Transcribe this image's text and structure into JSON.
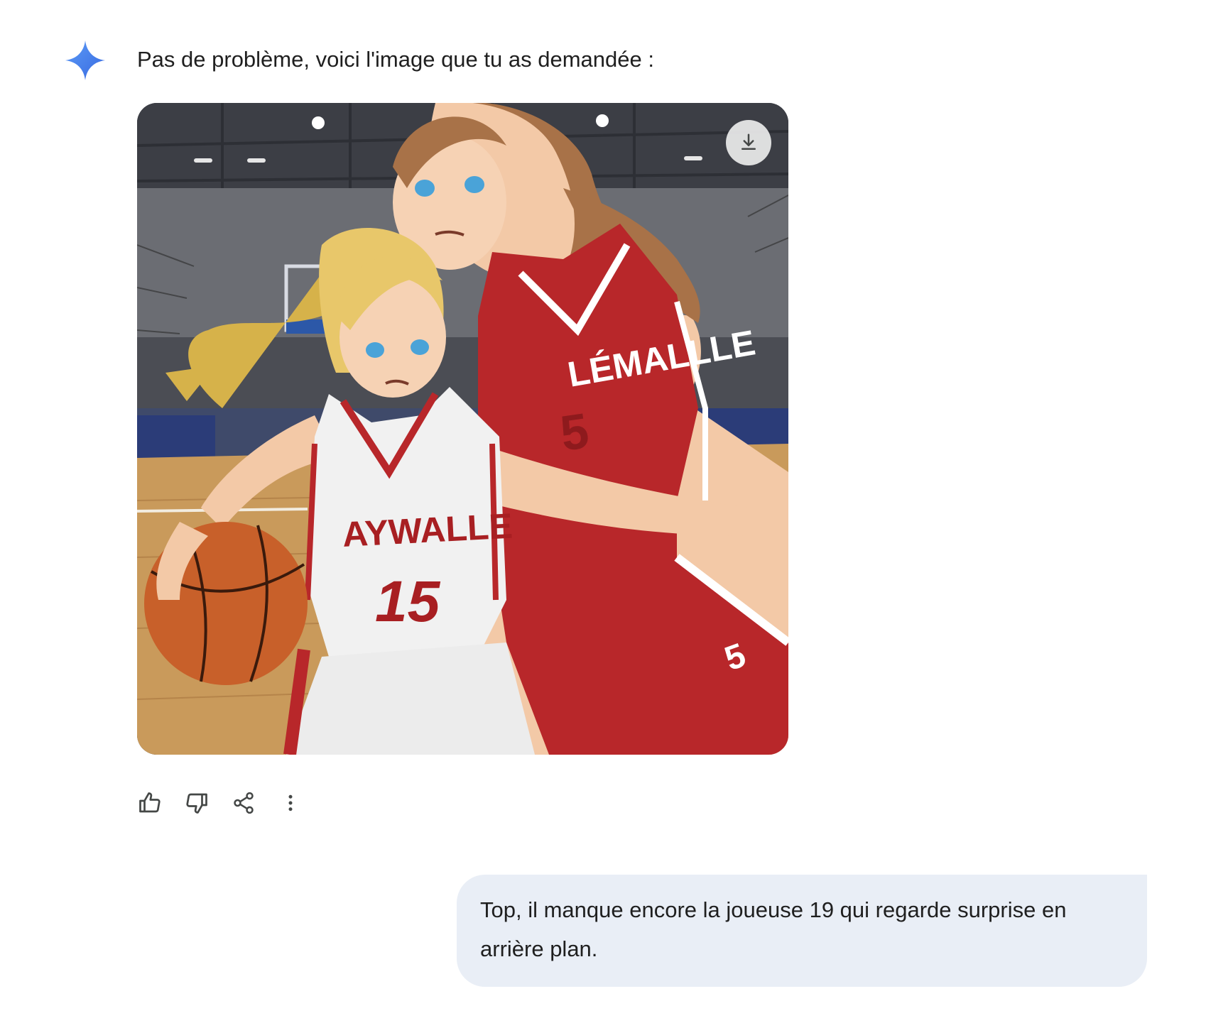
{
  "assistant": {
    "avatar_icon": "gemini-sparkle-icon",
    "message": "Pas de problème, voici l'image que tu as demandée :",
    "image": {
      "description_icon": "generated-image",
      "download_icon": "download-icon",
      "jersey_front_text": "AYWALLE",
      "jersey_front_number": "15",
      "jersey_back_text": "LÉMALLLE",
      "jersey_back_number": "5",
      "shorts_number": "5"
    },
    "actions": [
      {
        "icon": "thumbs-up-icon"
      },
      {
        "icon": "thumbs-down-icon"
      },
      {
        "icon": "share-icon"
      },
      {
        "icon": "more-vert-icon"
      }
    ]
  },
  "user": {
    "message": "Top, il manque encore la joueuse 19 qui regarde surprise en arrière plan."
  },
  "colors": {
    "bubble_bg": "#e9eef6",
    "icon": "#444746",
    "sparkle_start": "#4f8df5",
    "sparkle_end": "#3a6fe0"
  }
}
